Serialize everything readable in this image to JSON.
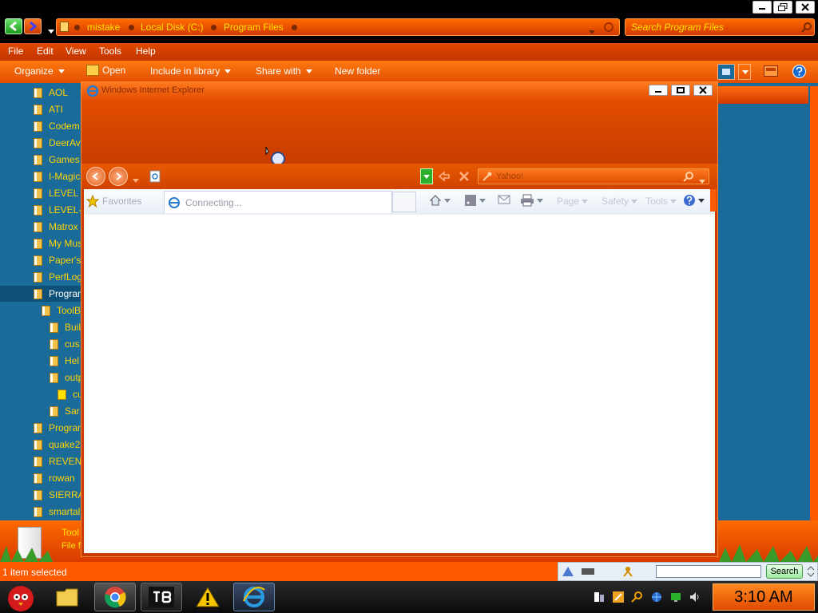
{
  "explorer": {
    "breadcrumb": [
      "mistake",
      "Local Disk (C:)",
      "Program Files"
    ],
    "search_placeholder": "Search Program Files",
    "menu": [
      "File",
      "Edit",
      "View",
      "Tools",
      "Help"
    ],
    "commands": {
      "organize": "Organize",
      "open": "Open",
      "include": "Include in library",
      "share": "Share with",
      "new_folder": "New folder"
    },
    "tree": [
      {
        "label": "AOL"
      },
      {
        "label": "ATI"
      },
      {
        "label": "Codem"
      },
      {
        "label": "DeerAv"
      },
      {
        "label": "Games"
      },
      {
        "label": "I-Magic"
      },
      {
        "label": "LEVEL"
      },
      {
        "label": "LEVEL-"
      },
      {
        "label": "Matrox"
      },
      {
        "label": "My Mus"
      },
      {
        "label": "Paper's"
      },
      {
        "label": "PerfLog"
      },
      {
        "label": "Progran"
      },
      {
        "label": "ToolB"
      },
      {
        "label": "Buil"
      },
      {
        "label": "cus"
      },
      {
        "label": "Hel"
      },
      {
        "label": "outp"
      },
      {
        "label": "cu"
      },
      {
        "label": "Sar"
      },
      {
        "label": "Progran"
      },
      {
        "label": "quake2"
      },
      {
        "label": "REVEN"
      },
      {
        "label": "rowan"
      },
      {
        "label": "SIERRA"
      },
      {
        "label": "smartal"
      }
    ],
    "details": {
      "name": "Tool",
      "type": "File f"
    },
    "status": "1 item selected"
  },
  "ie": {
    "title": "Windows Internet Explorer",
    "search_placeholder": "Yahoo!",
    "favorites": "Favorites",
    "tab_label": "Connecting...",
    "toolbar": {
      "page": "Page",
      "safety": "Safety",
      "tools": "Tools"
    }
  },
  "deskbar": {
    "search_button": "Search"
  },
  "taskbar": {
    "clock": "3:10 AM"
  },
  "colors": {
    "accent": "#ff5a00",
    "tree_bg": "#1a6b9a",
    "folder_text": "#ffd400"
  }
}
